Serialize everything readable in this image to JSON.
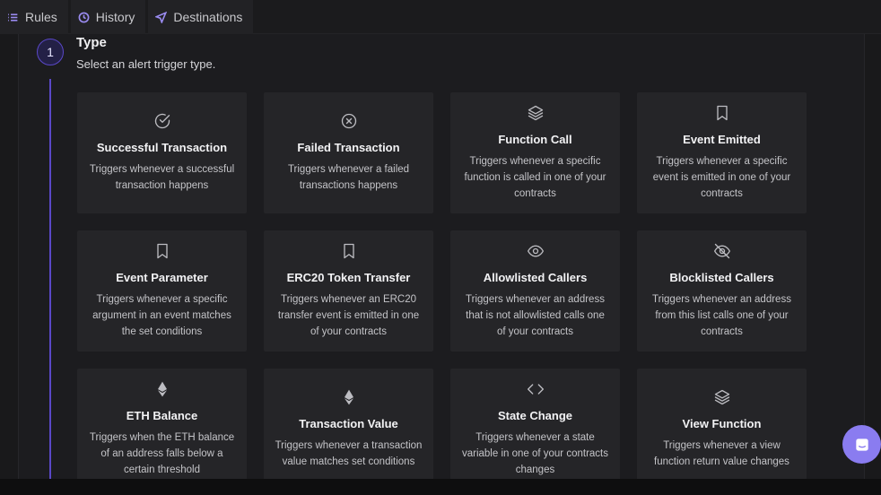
{
  "tabs": [
    {
      "label": "Rules",
      "icon": "list-icon"
    },
    {
      "label": "History",
      "icon": "clock-icon"
    },
    {
      "label": "Destinations",
      "icon": "send-icon"
    }
  ],
  "step": {
    "number": "1",
    "title": "Type",
    "subtitle": "Select an alert trigger type."
  },
  "cards": [
    {
      "icon": "check-circle-icon",
      "name": "Successful Transaction",
      "desc": "Triggers whenever a successful transaction happens"
    },
    {
      "icon": "x-circle-icon",
      "name": "Failed Transaction",
      "desc": "Triggers whenever a failed transactions happens"
    },
    {
      "icon": "layers-icon",
      "name": "Function Call",
      "desc": "Triggers whenever a specific function is called in one of your contracts"
    },
    {
      "icon": "bookmark-icon",
      "name": "Event Emitted",
      "desc": "Triggers whenever a specific event is emitted in one of your contracts"
    },
    {
      "icon": "bookmark-icon",
      "name": "Event Parameter",
      "desc": "Triggers whenever a specific argument in an event matches the set conditions"
    },
    {
      "icon": "bookmark-icon",
      "name": "ERC20 Token Transfer",
      "desc": "Triggers whenever an ERC20 transfer event is emitted in one of your contracts"
    },
    {
      "icon": "eye-icon",
      "name": "Allowlisted Callers",
      "desc": "Triggers whenever an address that is not allowlisted calls one of your contracts"
    },
    {
      "icon": "eye-off-icon",
      "name": "Blocklisted Callers",
      "desc": "Triggers whenever an address from this list calls one of your contracts"
    },
    {
      "icon": "ethereum-icon",
      "name": "ETH Balance",
      "desc": "Triggers when the ETH balance of an address falls below a certain threshold"
    },
    {
      "icon": "ethereum-icon",
      "name": "Transaction Value",
      "desc": "Triggers whenever a transaction value matches set conditions"
    },
    {
      "icon": "code-icon",
      "name": "State Change",
      "desc": "Triggers whenever a state variable in one of your contracts changes"
    },
    {
      "icon": "layers-icon",
      "name": "View Function",
      "desc": "Triggers whenever a view function return value changes"
    }
  ],
  "colors": {
    "accent": "#5a48c8",
    "chat_button": "#8a7cf0",
    "card_bg": "#252528"
  }
}
